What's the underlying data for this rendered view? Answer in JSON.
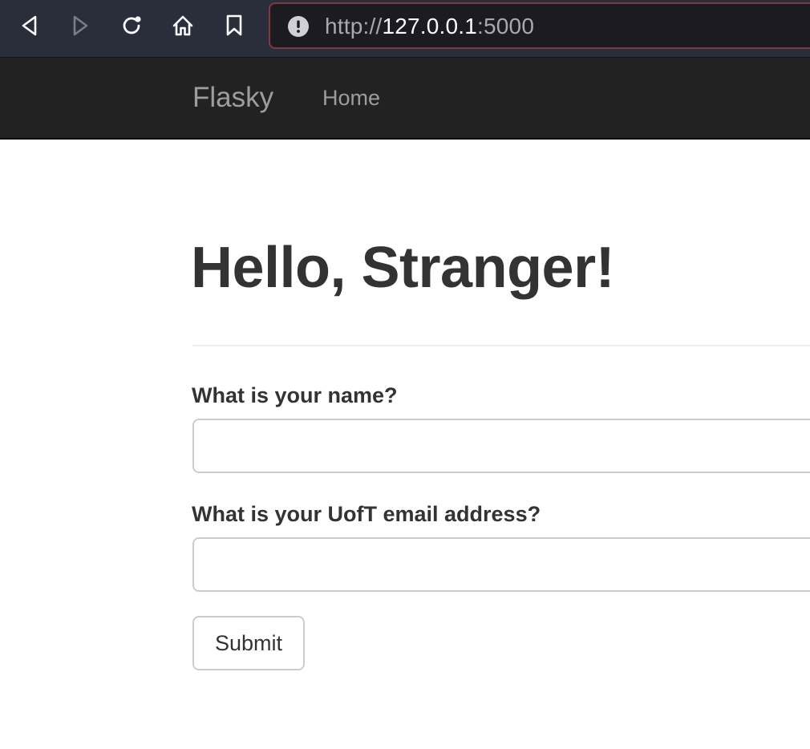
{
  "browser": {
    "url_scheme": "http://",
    "url_host": "127.0.0.1",
    "url_port": ":5000",
    "icons": {
      "back": "back-arrow-icon",
      "forward": "forward-arrow-icon",
      "reload": "reload-icon",
      "home": "home-icon",
      "bookmark": "bookmark-icon",
      "site_info": "warning-info-icon"
    }
  },
  "navbar": {
    "brand": "Flasky",
    "links": [
      {
        "label": "Home"
      }
    ]
  },
  "main": {
    "heading": "Hello, Stranger!",
    "form": {
      "name_label": "What is your name?",
      "name_value": "",
      "email_label": "What is your UofT email address?",
      "email_value": "",
      "submit_label": "Submit"
    }
  },
  "colors": {
    "navbar_bg": "#222222",
    "navbar_text": "#9d9d9d",
    "text": "#333333",
    "input_border": "#cccccc",
    "urlbar_border": "#7f3b3b"
  }
}
